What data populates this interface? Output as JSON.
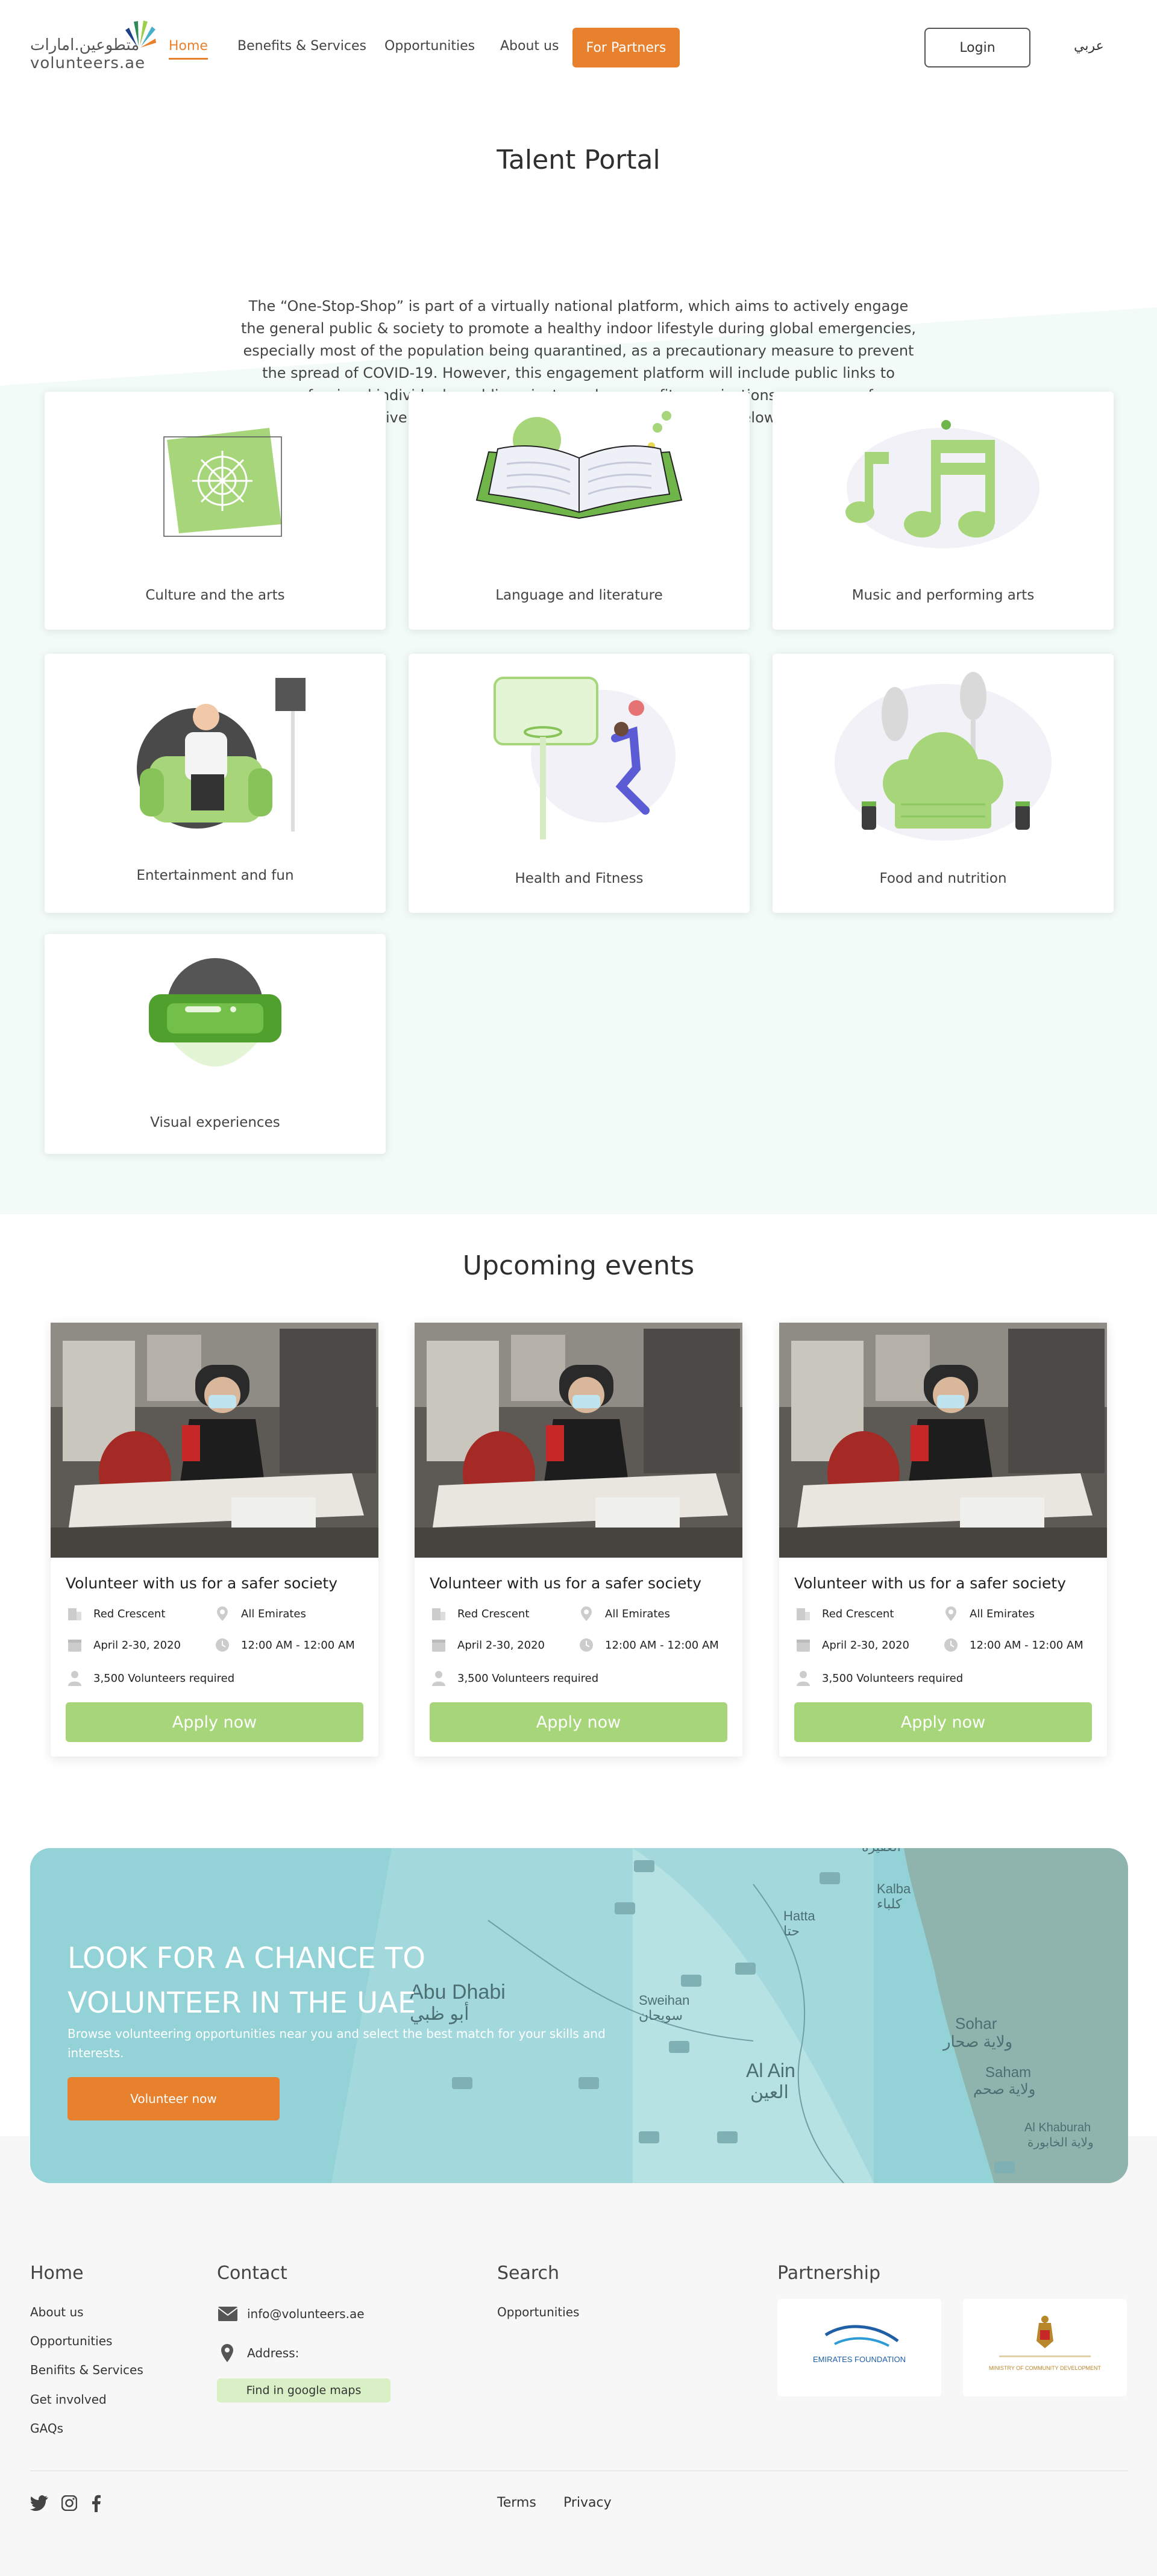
{
  "header": {
    "logo_arabic": "متطوعين.امارات",
    "logo_english": "volunteers.ae",
    "nav": [
      "Home",
      "Benefits & Services",
      "Opportunities",
      "About us"
    ],
    "partners_label": "For Partners",
    "login_label": "Login",
    "lang_label": "عربي"
  },
  "talent": {
    "title": "Talent Portal",
    "intro": "The “One-Stop-Shop” is part of a virtually national platform, which aims to actively engage the general public & society to promote a healthy indoor lifestyle during global emergencies, especially most of the population being quarantined, as a precautionary measure to prevent the spread of COVID-19. However, this engagement platform will include public links to professional individuals, public, private and non-profit organizations, as source of informative activities, and learning resources within the below sectors",
    "sectors": [
      "Culture and the arts",
      "Language and literature",
      "Music and performing arts",
      "Entertainment and fun",
      "Health and Fitness",
      "Food and nutrition",
      "Visual experiences"
    ]
  },
  "events": {
    "title": "Upcoming events",
    "items": [
      {
        "title": "Volunteer with us for a safer society",
        "org": "Red Crescent",
        "location": "All Emirates",
        "date": "April 2-30, 2020",
        "time": "12:00 AM - 12:00 AM",
        "volunteers": "3,500 Volunteers required",
        "apply": "Apply now"
      },
      {
        "title": "Volunteer with us for a safer society",
        "org": "Red Crescent",
        "location": "All Emirates",
        "date": "April 2-30, 2020",
        "time": "12:00 AM - 12:00 AM",
        "volunteers": "3,500 Volunteers required",
        "apply": "Apply now"
      },
      {
        "title": "Volunteer with us for a safer society",
        "org": "Red Crescent",
        "location": "All Emirates",
        "date": "April 2-30, 2020",
        "time": "12:00 AM - 12:00 AM",
        "volunteers": "3,500 Volunteers required",
        "apply": "Apply now"
      }
    ]
  },
  "banner": {
    "heading_line1": "LOOK FOR A CHANCE TO",
    "heading_line2": "VOLUNTEER IN THE UAE",
    "text": "Browse volunteering opportunities near you and select the best match for your skills and interests.",
    "button": "Volunteer now",
    "map_labels": [
      "Abu Dhabi",
      "أبو ظبي",
      "Sweihan",
      "سويحان",
      "Al Ain",
      "العين",
      "Hatta",
      "حتا",
      "Kalba",
      "كلباء",
      "Sohar",
      "ولاية صحار",
      "Saham",
      "ولاية صحم",
      "Al Khaburah",
      "ولاية الخابورة",
      "العقيرة"
    ]
  },
  "footer": {
    "home_heading": "Home",
    "home_links": [
      "About us",
      "Opportunities",
      "Benifits & Services",
      "Get involved",
      "GAQs"
    ],
    "contact_heading": "Contact",
    "email": "info@volunteers.ae",
    "address_label": "Address:",
    "maps_button": "Find in google maps",
    "search_heading": "Search",
    "search_links": [
      "Opportunities"
    ],
    "partnership_heading": "Partnership",
    "partner1": "EMIRATES FOUNDATION",
    "partner2": "MINISTRY OF COMMUNITY DEVELOPMENT",
    "terms": "Terms",
    "privacy": "Privacy"
  },
  "colors": {
    "accent": "#e8812d",
    "green": "#a6d679",
    "mint_bg": "#f2fbf8",
    "banner": "#93d2d6"
  }
}
